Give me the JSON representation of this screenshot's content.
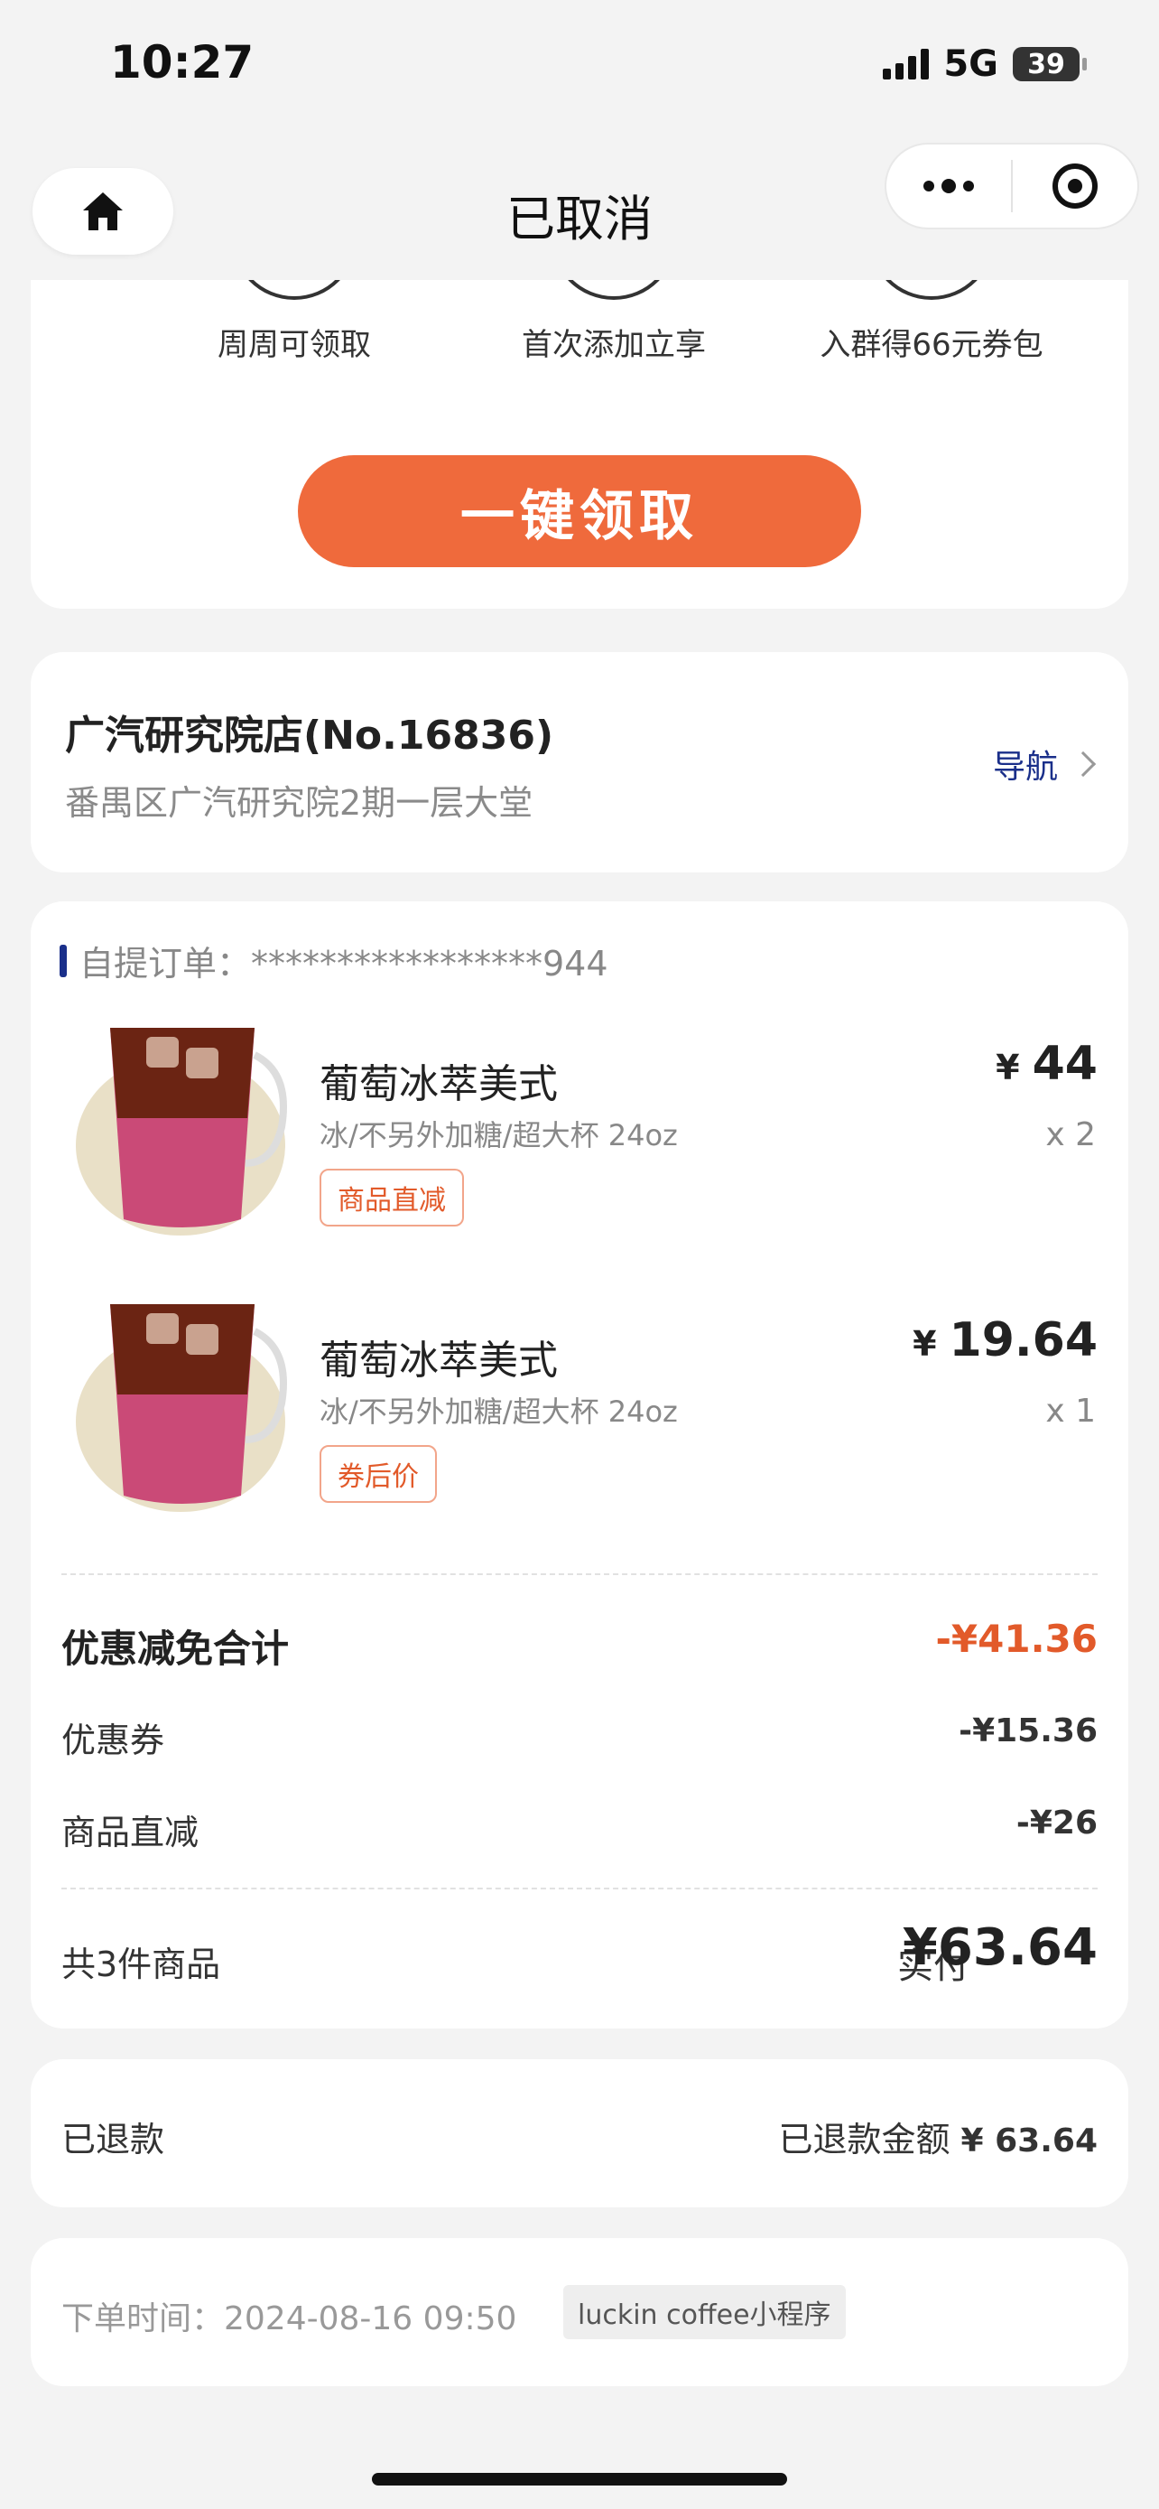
{
  "status": {
    "time": "10:27",
    "network": "5G",
    "battery": "39"
  },
  "nav": {
    "title": "已取消"
  },
  "promo": {
    "items": [
      {
        "label": "周周可领取",
        "icon": "gift-card-icon"
      },
      {
        "label": "首次添加立享",
        "icon": "coupon-icon"
      },
      {
        "label": "入群得66元券包",
        "icon": "gift-box-icon"
      }
    ],
    "claim_button": "一键领取"
  },
  "store": {
    "name": "广汽研究院店(No.16836)",
    "address": "番禺区广汽研究院2期一层大堂",
    "nav_label": "导航"
  },
  "order": {
    "header": "自提订单：*****************944",
    "items": [
      {
        "name": "葡萄冰萃美式",
        "spec": "冰/不另外加糖/超大杯 24oz",
        "tag": "商品直减",
        "price": "44",
        "qty": "x 2"
      },
      {
        "name": "葡萄冰萃美式",
        "spec": "冰/不另外加糖/超大杯 24oz",
        "tag": "券后价",
        "price": "19.64",
        "qty": "x 1"
      }
    ],
    "currency": "¥",
    "discount_total_label": "优惠减免合计",
    "discount_total_value": "-¥41.36",
    "coupon_label": "优惠券",
    "coupon_value": "-¥15.36",
    "direct_label": "商品直减",
    "direct_value": "-¥26",
    "count_label": "共3件商品",
    "paid_label": "实付",
    "paid_value": "¥63.64"
  },
  "refund": {
    "status": "已退款",
    "amount_label": "已退款金额",
    "amount_value": "¥ 63.64"
  },
  "meta": {
    "order_time": "下单时间：2024-08-16 09:50",
    "source_badge": "luckin coffee小程序"
  },
  "colors": {
    "accent": "#ef6a3c",
    "nav_blue": "#1a2f8a",
    "discount": "#e25a2a"
  }
}
